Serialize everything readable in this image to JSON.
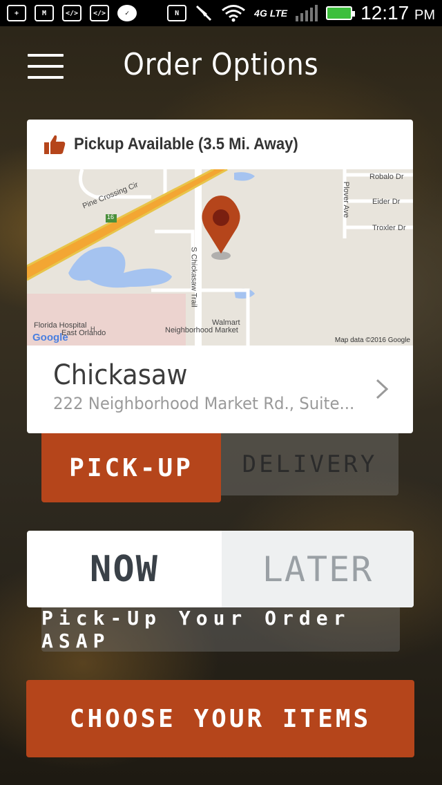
{
  "status_bar": {
    "icons": [
      "add-icon",
      "gmail-icon",
      "code-icon",
      "code-icon",
      "check-icon",
      "nfc-icon",
      "mute-icon",
      "wifi-icon",
      "lte-icon",
      "signal-icon",
      "battery-icon"
    ],
    "network": "4G LTE",
    "time": "12:17",
    "ampm": "PM"
  },
  "header": {
    "title": "Order Options"
  },
  "location": {
    "availability": "Pickup Available (3.5 Mi. Away)",
    "store_name": "Chickasaw",
    "address": "222 Neighborhood Market Rd., Suite...",
    "map": {
      "labels": [
        "Robalo Dr",
        "Eider Dr",
        "Troxler Dr",
        "Plover Ave",
        "Pine Crossing Cir",
        "S Chickasaw Trail",
        "16",
        "Walmart",
        "Neighborhood Market",
        "Florida Hospital",
        "East Orlando",
        "H"
      ],
      "attribution": "Map data ©2016 Google",
      "logo": "Google"
    }
  },
  "mode": {
    "pickup_label": "PICK-UP",
    "delivery_label": "DELIVERY",
    "selected": "pickup"
  },
  "timing": {
    "now_label": "NOW",
    "later_label": "LATER",
    "selected": "now",
    "note": "Pick-Up Your Order ASAP"
  },
  "cta": {
    "label": "CHOOSE YOUR ITEMS"
  },
  "colors": {
    "accent": "#b5451b",
    "card_bg": "#ffffff",
    "text_dark": "#3a4148",
    "text_muted": "#9a9a9a"
  }
}
